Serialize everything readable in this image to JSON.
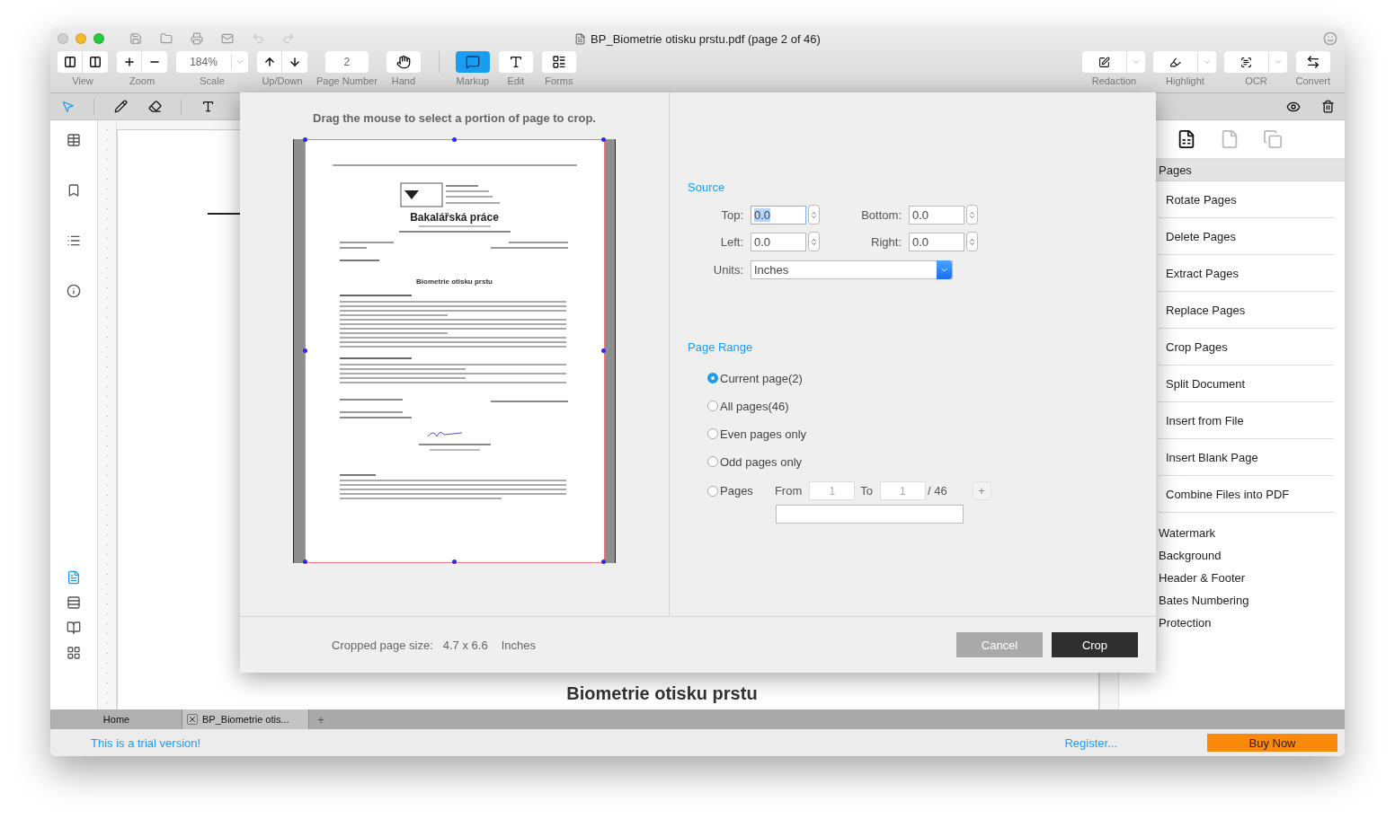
{
  "window": {
    "title": "BP_Biometrie otisku prstu.pdf (page 2 of 46)"
  },
  "toolbar": {
    "left": [
      {
        "label": "View",
        "kind": "pair",
        "selected": false
      },
      {
        "label": "Zoom",
        "kind": "pair",
        "selected": false
      },
      {
        "label": "Scale",
        "kind": "dropdown",
        "value": "184%",
        "selected": false
      },
      {
        "label": "Up/Down",
        "kind": "pair",
        "selected": false
      },
      {
        "label": "Page Number",
        "kind": "field",
        "value": "2",
        "selected": false
      },
      {
        "label": "Hand",
        "kind": "button",
        "selected": false
      },
      {
        "label": "Markup",
        "kind": "button",
        "selected": true
      },
      {
        "label": "Edit",
        "kind": "button",
        "selected": false
      },
      {
        "label": "Forms",
        "kind": "button",
        "selected": false
      }
    ],
    "right": [
      {
        "label": "Redaction",
        "kind": "split"
      },
      {
        "label": "Highlight",
        "kind": "split"
      },
      {
        "label": "OCR",
        "kind": "split"
      },
      {
        "label": "Convert",
        "kind": "button"
      }
    ]
  },
  "annotation_tools": [
    {
      "selected": true
    },
    {
      "selected": false
    },
    {
      "selected": false
    },
    {
      "selected": false
    }
  ],
  "left_rail": {
    "view_modes": [
      {
        "selected": true
      },
      {
        "selected": false
      },
      {
        "selected": false
      },
      {
        "selected": false
      }
    ]
  },
  "document": {
    "heading": "Biometrie otisku prstu"
  },
  "right_panel": {
    "view_tabs": [
      {
        "selected": true
      },
      {
        "selected": false
      },
      {
        "selected": false
      }
    ],
    "section_title": "Pages",
    "page_tools": [
      "Rotate Pages",
      "Delete Pages",
      "Extract Pages",
      "Replace Pages",
      "Crop Pages",
      "Split Document",
      "Insert from File",
      "Insert Blank Page",
      "Combine Files into PDF"
    ],
    "more_tools": [
      "Watermark",
      "Background",
      "Header & Footer",
      "Bates Numbering",
      "Protection"
    ]
  },
  "dialog": {
    "instruction": "Drag the mouse to select a portion of page to crop.",
    "preview": {
      "title": "Bakalářská práce",
      "topic": "Biometrie otisku prstu"
    },
    "source": {
      "title": "Source",
      "fields": [
        {
          "label": "Top:",
          "value": "0.0",
          "selected": true
        },
        {
          "label": "Bottom:",
          "value": "0.0",
          "selected": false
        },
        {
          "label": "Left:",
          "value": "0.0",
          "selected": false
        },
        {
          "label": "Right:",
          "value": "0.0",
          "selected": false
        }
      ],
      "units": {
        "label": "Units:",
        "value": "Inches"
      }
    },
    "page_range": {
      "title": "Page Range",
      "options": [
        {
          "label": "Current page(2)",
          "selected": true
        },
        {
          "label": "All pages(46)",
          "selected": false
        },
        {
          "label": "Even pages only",
          "selected": false
        },
        {
          "label": "Odd pages only",
          "selected": false
        },
        {
          "label": "Pages",
          "selected": false
        }
      ],
      "from_label": "From",
      "from_value": "1",
      "to_label": "To",
      "to_value": "1",
      "total": "/ 46",
      "add": "+"
    },
    "footer": {
      "size_label": "Cropped page size:",
      "size_value": "4.7 x 6.6",
      "unit": "Inches"
    },
    "buttons": [
      {
        "label": "Cancel",
        "kind": "secondary"
      },
      {
        "label": "Crop",
        "kind": "primary"
      }
    ]
  },
  "tabs": [
    {
      "label": "Home",
      "selected": false,
      "closable": false
    },
    {
      "label": "BP_Biometrie otis...",
      "selected": true,
      "closable": true
    }
  ],
  "new_tab": "+",
  "status_bar": {
    "trial": "This is a trial version!",
    "register": "Register...",
    "buy": "Buy Now"
  }
}
